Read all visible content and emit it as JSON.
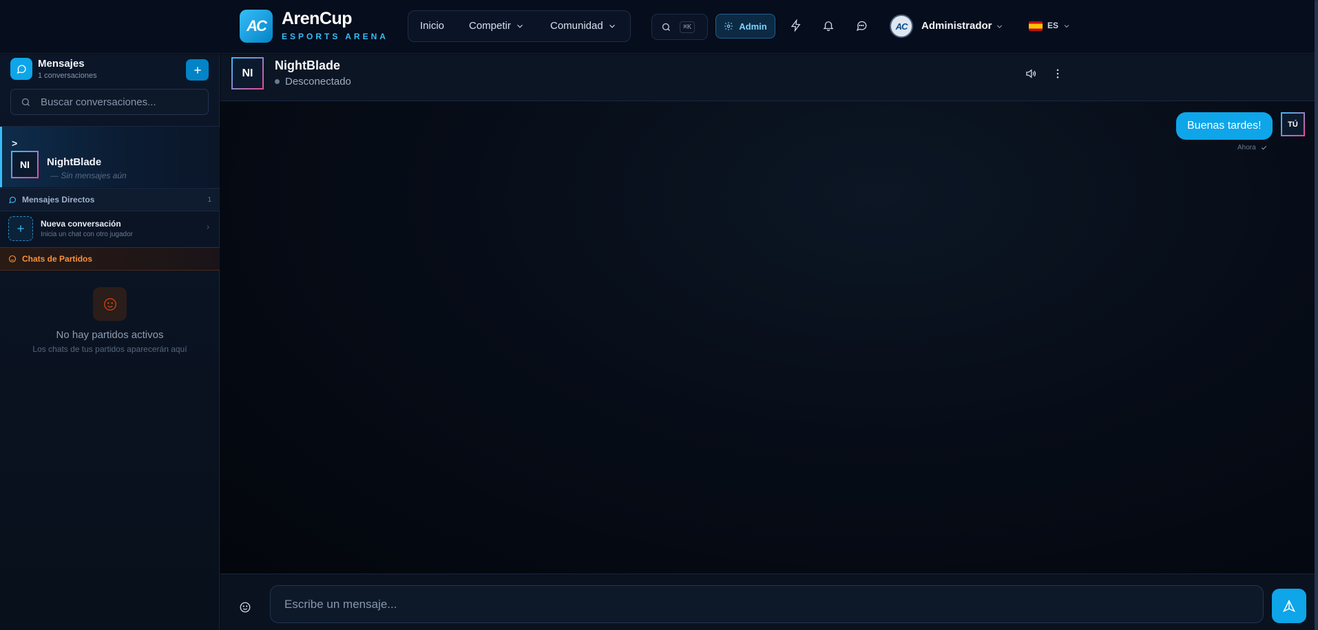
{
  "brand": {
    "logo_text": "AC",
    "name": "ArenCup",
    "subtitle": "ESPORTS ARENA"
  },
  "nav": {
    "items": [
      {
        "label": "Inicio"
      },
      {
        "label": "Competir"
      },
      {
        "label": "Comunidad"
      }
    ],
    "search_shortcut": "⌘K",
    "admin_label": "Admin",
    "user": {
      "avatar_text": "AC",
      "name": "Administrador"
    },
    "language": "ES"
  },
  "sidebar": {
    "title": "Mensajes",
    "count": "1 conversaciones",
    "search_placeholder": "Buscar conversaciones...",
    "conversation": {
      "caret": ">",
      "initials": "NI",
      "name": "NightBlade",
      "last_message": "—  Sin mensajes aún"
    },
    "direct": {
      "label": "Mensajes Directos",
      "count": "1"
    },
    "new_conversation": {
      "title": "Nueva conversación",
      "subtitle": "Inicia un chat con otro jugador"
    },
    "match_chats": {
      "label": "Chats de Partidos"
    },
    "empty": {
      "title": "No hay partidos activos",
      "subtitle": "Los chats de tus partidos aparecerán aquí"
    }
  },
  "chat": {
    "contact": {
      "initials": "NI",
      "name": "NightBlade",
      "status": "Desconectado"
    },
    "messages": [
      {
        "text": "Buenas tardes!",
        "sender": "TÚ",
        "time": "Ahora"
      }
    ],
    "composer_placeholder": "Escribe un mensaje..."
  },
  "colors": {
    "accent": "#0ea5e9",
    "match_accent": "#fb923c",
    "background": "#050a14"
  }
}
